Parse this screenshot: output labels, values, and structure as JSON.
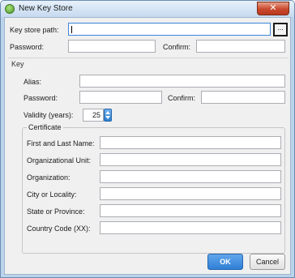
{
  "window": {
    "title": "New Key Store",
    "close_glyph": "✕"
  },
  "keystore": {
    "path_label": "Key store path:",
    "path_value": "",
    "browse_label": "...",
    "password_label": "Password:",
    "confirm_label": "Confirm:"
  },
  "key": {
    "section_label": "Key",
    "alias_label": "Alias:",
    "password_label": "Password:",
    "confirm_label": "Confirm:",
    "validity_label": "Validity (years):",
    "validity_value": "25"
  },
  "certificate": {
    "legend": "Certificate",
    "fields": [
      {
        "label": "First and Last Name:"
      },
      {
        "label": "Organizational Unit:"
      },
      {
        "label": "Organization:"
      },
      {
        "label": "City or Locality:"
      },
      {
        "label": "State or Province:"
      },
      {
        "label": "Country Code (XX):"
      }
    ]
  },
  "buttons": {
    "ok": "OK",
    "cancel": "Cancel"
  },
  "colors": {
    "accent": "#2f7fd5",
    "frame": "#bcd3ec",
    "close": "#c9482c"
  }
}
